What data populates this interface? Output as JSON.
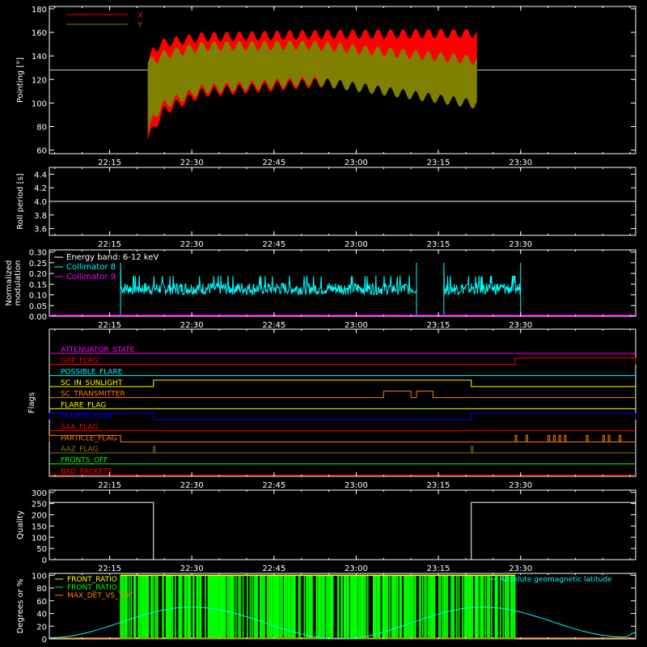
{
  "chart_data": [
    {
      "type": "line",
      "ylabel": "Pointing [°]",
      "ylim": [
        57,
        182
      ],
      "yticks": [
        60,
        80,
        100,
        120,
        140,
        160,
        180
      ],
      "xticks": [
        "22:15",
        "22:30",
        "22:45",
        "23:00",
        "23:15",
        "23:30"
      ],
      "legend": [
        "X",
        "Y"
      ],
      "legend_placement": "top-left",
      "reference_line": 128,
      "series": [
        {
          "name": "X",
          "color": "#ff0000",
          "x_range": [
            "22:22",
            "23:22"
          ],
          "envelope_high": [
            [
              0,
              135
            ],
            [
              1,
              150
            ],
            [
              3,
              155
            ],
            [
              10,
              160
            ],
            [
              30,
              162
            ],
            [
              60,
              163
            ]
          ],
          "envelope_low": [
            [
              0,
              65
            ],
            [
              1,
              75
            ],
            [
              3,
              90
            ],
            [
              10,
              105
            ],
            [
              30,
              113
            ],
            [
              60,
              115
            ]
          ]
        },
        {
          "name": "Y",
          "color": "#808000",
          "x_range": [
            "22:22",
            "23:22"
          ],
          "envelope_high": [
            [
              0,
              138
            ],
            [
              1,
              140
            ],
            [
              3,
              145
            ],
            [
              10,
              152
            ],
            [
              30,
              153
            ],
            [
              60,
              140
            ]
          ],
          "envelope_low": [
            [
              0,
              70
            ],
            [
              1,
              85
            ],
            [
              3,
              95
            ],
            [
              10,
              108
            ],
            [
              30,
              115
            ],
            [
              60,
              95
            ]
          ]
        }
      ]
    },
    {
      "type": "line",
      "ylabel": "Roll period [s]",
      "ylim": [
        3.5,
        4.5
      ],
      "yticks": [
        "3.6",
        "3.8",
        "4.0",
        "4.2",
        "4.4"
      ],
      "xticks": [
        "22:15",
        "22:30",
        "22:45",
        "23:00",
        "23:15",
        "23:30"
      ],
      "series": [
        {
          "value": 4.0,
          "color": "#ffffff"
        }
      ]
    },
    {
      "type": "line",
      "ylabel": [
        "Normalized",
        "modulation"
      ],
      "ylim": [
        0,
        0.31
      ],
      "yticks": [
        "0.00",
        "0.05",
        "0.10",
        "0.15",
        "0.20",
        "0.25",
        "0.30"
      ],
      "xticks": [
        "22:15",
        "22:30",
        "22:45",
        "23:00",
        "23:15",
        "23:30"
      ],
      "legend_title": "Energy band: 6-12 keV",
      "series": [
        {
          "name": "Collimator 8",
          "color": "#00ffff",
          "segments": [
            [
              "22:17",
              "23:11",
              0.13
            ],
            [
              "23:16",
              "23:30",
              0.13
            ]
          ]
        },
        {
          "name": "Collimator 9",
          "color": "#ff00ff",
          "value": 0.0
        }
      ]
    },
    {
      "type": "timeline",
      "ylabel": "Flags",
      "xticks": [
        "22:15",
        "22:30",
        "22:45",
        "23:00",
        "23:15",
        "23:30"
      ],
      "flags": [
        {
          "name": "ATTENUATOR_STATE",
          "color": "#ff00ff"
        },
        {
          "name": "GAP_FLAG",
          "color": "#ff0000",
          "high": [
            [
              "23:29",
              "end"
            ]
          ]
        },
        {
          "name": "POSSIBLE_FLARE",
          "color": "#00ffff"
        },
        {
          "name": "SC_IN_SUNLIGHT",
          "color": "#ffff00",
          "high": [
            [
              "22:23",
              "23:21"
            ]
          ]
        },
        {
          "name": "SC_TRANSMITTER",
          "color": "#ff8000",
          "high": [
            [
              "23:05",
              "23:10"
            ],
            [
              "23:11",
              "23:14"
            ]
          ]
        },
        {
          "name": "FLARE_FLAG",
          "color": "#ffff00"
        },
        {
          "name": "ECLIPSE_FLAG",
          "color": "#0000ff",
          "high": [
            [
              "start",
              "22:23"
            ],
            [
              "23:21",
              "end"
            ]
          ]
        },
        {
          "name": "SAA_FLAG",
          "color": "#ff0000"
        },
        {
          "name": "PARTICLE_FLAG",
          "color": "#ff8000",
          "high": [
            [
              "start",
              "22:17"
            ]
          ],
          "spikes": [
            "23:29",
            "23:31",
            "23:35",
            "23:36",
            "23:37",
            "23:38",
            "23:42",
            "23:45",
            "23:46",
            "23:48"
          ]
        },
        {
          "name": "AAZ_FLAG",
          "color": "#808000",
          "spikes": [
            "22:23",
            "23:21"
          ]
        },
        {
          "name": "FRONTS_OFF",
          "color": "#00ff00"
        },
        {
          "name": "BAD_PACKETS",
          "color": "#ff0000"
        }
      ]
    },
    {
      "type": "line",
      "ylabel": "Quality",
      "ylim": [
        0,
        310
      ],
      "yticks": [
        0,
        50,
        100,
        150,
        200,
        250,
        300
      ],
      "xticks": [
        "22:15",
        "22:30",
        "22:45",
        "23:00",
        "23:15",
        "23:30"
      ],
      "series": [
        {
          "color": "#ffffff",
          "steps": [
            [
              "start",
              255
            ],
            [
              "22:23",
              0
            ],
            [
              "23:21",
              255
            ]
          ]
        }
      ]
    },
    {
      "type": "line",
      "ylabel": "Degrees or %",
      "ylim": [
        0,
        103
      ],
      "yticks": [
        0,
        20,
        40,
        60,
        80,
        100
      ],
      "legend_left": [
        "FRONT_RATIO",
        "FRONT_RATIO_ 2",
        "MAX_DET_VS_TOT"
      ],
      "legend_right": "Absolute geomagnetic latitude",
      "series": [
        {
          "name": "FRONT_RATIO",
          "color": "#ffff00",
          "range": [
            "22:17",
            "23:29"
          ],
          "value": 100
        },
        {
          "name": "FRONT_RATIO_ 2",
          "color": "#00ff00",
          "range": [
            "22:17",
            "23:29"
          ],
          "style": "dense-bars"
        },
        {
          "name": "MAX_DET_VS_TOT",
          "color": "#ff8000",
          "value": 0
        },
        {
          "name": "Absolute geomagnetic latitude",
          "color": "#00ffff",
          "points": [
            [
              "22:04",
              2
            ],
            [
              "22:30",
              50
            ],
            [
              "22:57",
              0
            ],
            [
              "23:23",
              50
            ],
            [
              "23:49",
              3
            ],
            [
              "23:51",
              10
            ]
          ]
        }
      ]
    }
  ],
  "colors": {
    "axis": "#ffffff",
    "background": "#000000"
  }
}
